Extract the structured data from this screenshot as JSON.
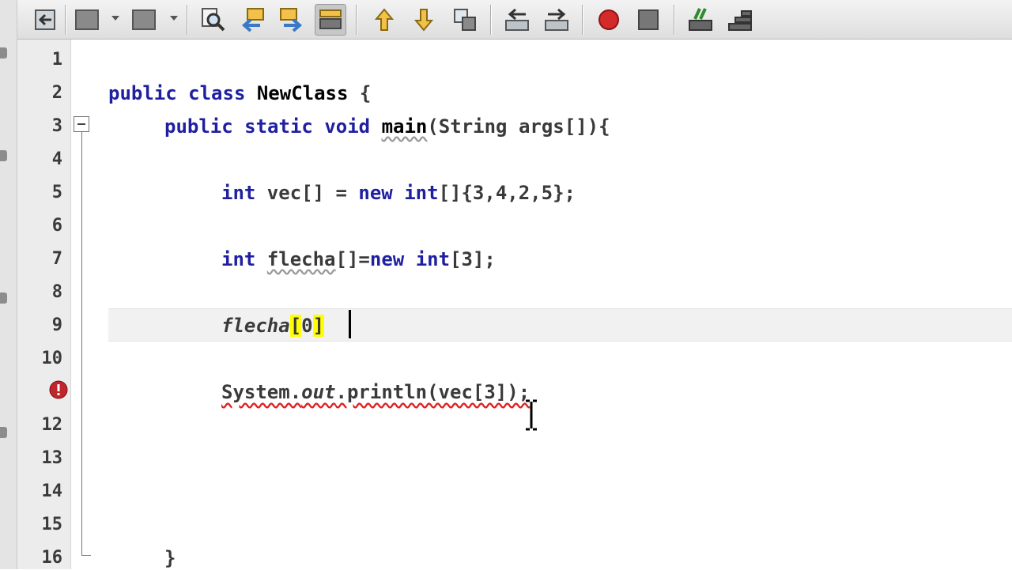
{
  "toolbar": {
    "icons": [
      "back-to-previous-edit-icon",
      "toggle-bookmark-icon",
      "next-bookmark-icon",
      "find-selection-icon",
      "find-previous-icon",
      "find-next-icon",
      "toggle-highlight-search-icon",
      "previous-bookmark-icon",
      "next-bookmark-down-icon",
      "toggle-rectangular-selection-icon",
      "shift-line-left-icon",
      "shift-line-right-icon",
      "start-macro-recording-icon",
      "stop-macro-recording-icon",
      "comment-icon",
      "uncomment-icon"
    ],
    "record_color": "#d42a2a"
  },
  "gutter": {
    "line_numbers": [
      "1",
      "2",
      "3",
      "4",
      "5",
      "6",
      "7",
      "8",
      "9",
      "10",
      "",
      "12",
      "13",
      "14",
      "15",
      "16"
    ],
    "error_line": "11",
    "error_color": "#c0272d"
  },
  "code": {
    "line2": {
      "kw1": "public",
      "kw2": "class",
      "name": "NewClass",
      "rest": " {"
    },
    "line3": {
      "kw1": "public",
      "kw2": "static",
      "kw3": "void",
      "name": "main",
      "rest": "(String args[]){"
    },
    "line5": {
      "kw1": "int",
      "mid": " vec[] = ",
      "kw2": "new",
      "kw3": "int",
      "rest": "[]{3,4,2,5};"
    },
    "line7": {
      "kw1": "int",
      "var": "flecha",
      "mid": "[]=",
      "kw2": "new",
      "kw3": "int",
      "rest": "[3];"
    },
    "line9": {
      "var": "flecha",
      "open": "[",
      "idx": "0",
      "close": "]"
    },
    "line11": {
      "a": "System.",
      "b": "out",
      "c": ".println(vec[3]);"
    },
    "line16": {
      "brace": "}"
    }
  },
  "colors": {
    "keyword": "#1f1fa0",
    "bracket_match": "#ffff00",
    "error_underline": "#e02020",
    "current_line": "#f1f1f1"
  }
}
